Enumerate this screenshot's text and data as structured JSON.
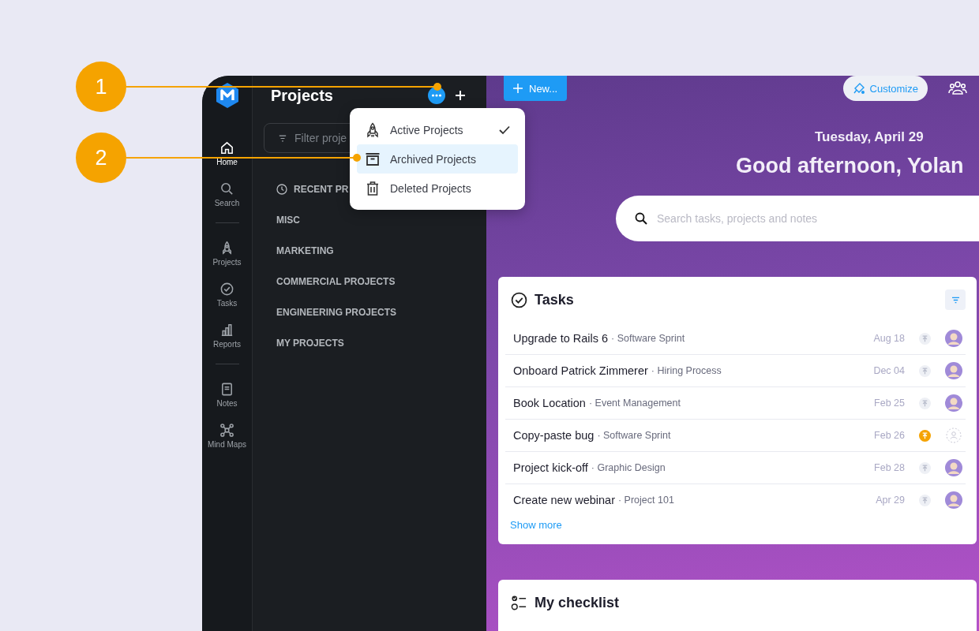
{
  "callouts": [
    "1",
    "2"
  ],
  "rail": {
    "groups": [
      [
        {
          "label": "Home",
          "selected": true
        },
        {
          "label": "Search",
          "selected": false
        }
      ],
      [
        {
          "label": "Projects",
          "selected": false
        },
        {
          "label": "Tasks",
          "selected": false
        },
        {
          "label": "Reports",
          "selected": false
        }
      ],
      [
        {
          "label": "Notes",
          "selected": false
        },
        {
          "label": "Mind Maps",
          "selected": false
        }
      ]
    ]
  },
  "projects_panel": {
    "title": "Projects",
    "filter": {
      "placeholder": "Filter proje"
    },
    "sections": [
      {
        "kind": "recent",
        "label": "RECENT PR"
      },
      {
        "kind": "group",
        "label": "MISC"
      },
      {
        "kind": "group",
        "label": "MARKETING"
      },
      {
        "kind": "group",
        "label": "COMMERCIAL PROJECTS"
      },
      {
        "kind": "group",
        "label": "ENGINEERING PROJECTS"
      },
      {
        "kind": "group",
        "label": "MY PROJECTS"
      }
    ]
  },
  "menu": [
    {
      "label": "Active Projects",
      "checked": true,
      "selected": false
    },
    {
      "label": "Archived Projects",
      "checked": false,
      "selected": true
    },
    {
      "label": "Deleted Projects",
      "checked": false,
      "selected": false
    }
  ],
  "toolbar": {
    "new_button": "New...",
    "customize_button": "Customize"
  },
  "date": "Tuesday, April 29",
  "greeting": "Good afternoon, Yolan",
  "search": {
    "placeholder": "Search tasks, projects and notes"
  },
  "tasks": {
    "title": "Tasks",
    "rows": [
      {
        "name": "Upgrade to Rails 6",
        "project": "· Software Sprint",
        "date": "Aug 18",
        "pinned": false,
        "assigned": true
      },
      {
        "name": "Onboard Patrick Zimmerer",
        "project": "· Hiring Process",
        "date": "Dec 04",
        "pinned": false,
        "assigned": true
      },
      {
        "name": "Book Location",
        "project": "· Event Management",
        "date": "Feb 25",
        "pinned": false,
        "assigned": true
      },
      {
        "name": "Copy-paste bug",
        "project": "· Software Sprint",
        "date": "Feb 26",
        "pinned": true,
        "assigned": false
      },
      {
        "name": "Project kick-off",
        "project": "· Graphic Design",
        "date": "Feb 28",
        "pinned": false,
        "assigned": true
      },
      {
        "name": "Create new webinar",
        "project": "· Project 101",
        "date": "Apr 29",
        "pinned": false,
        "assigned": true
      }
    ],
    "show_more": "Show more"
  },
  "checklist": {
    "title": "My checklist"
  }
}
